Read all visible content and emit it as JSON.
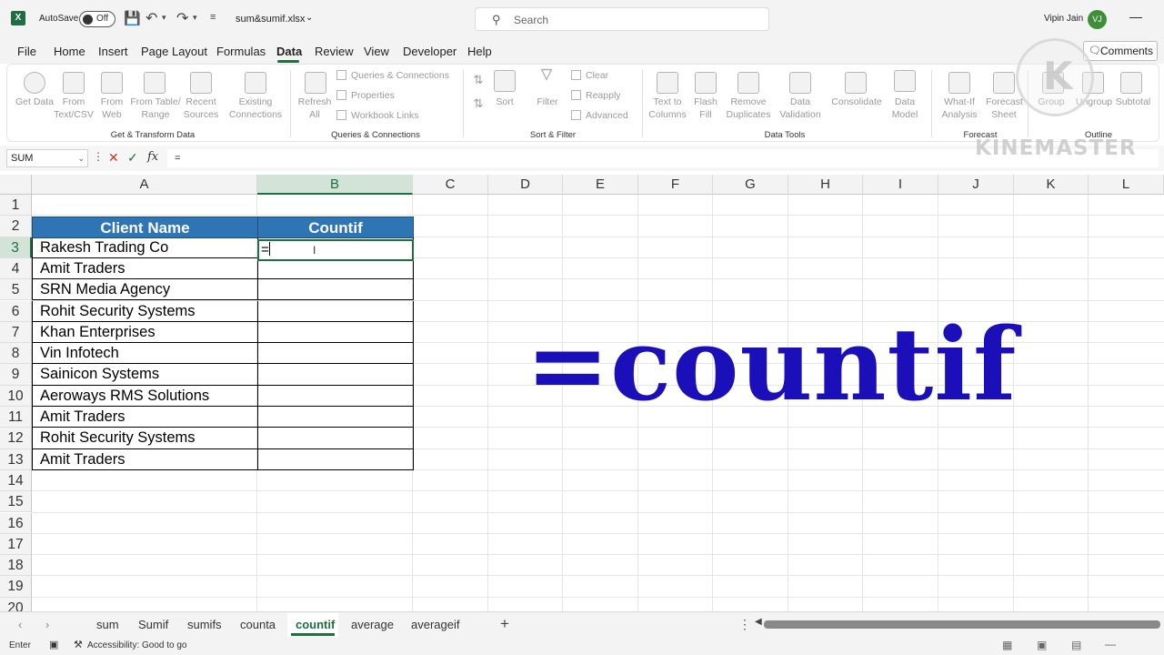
{
  "titlebar": {
    "autosave_label": "AutoSave",
    "autosave_state": "Off",
    "filename": "sum&sumif.xlsx",
    "search_placeholder": "Search",
    "user_name": "Vipin Jain",
    "user_initials": "VJ"
  },
  "menu": {
    "items": [
      "File",
      "Home",
      "Insert",
      "Page Layout",
      "Formulas",
      "Data",
      "Review",
      "View",
      "Developer",
      "Help"
    ],
    "active": "Data",
    "comments_label": "Comments"
  },
  "ribbon": {
    "get_data": "Get Data",
    "from_text_csv": "From Text/CSV",
    "from_web": "From Web",
    "from_table_range": "From Table/ Range",
    "recent_sources": "Recent Sources",
    "existing_connections": "Existing Connections",
    "group_get_transform": "Get & Transform Data",
    "refresh_all": "Refresh All",
    "queries_connections": "Queries & Connections",
    "properties": "Properties",
    "workbook_links": "Workbook Links",
    "group_queries": "Queries & Connections",
    "sort": "Sort",
    "filter": "Filter",
    "clear": "Clear",
    "reapply": "Reapply",
    "advanced": "Advanced",
    "group_sort_filter": "Sort & Filter",
    "text_to_columns": "Text to Columns",
    "flash_fill": "Flash Fill",
    "remove_duplicates": "Remove Duplicates",
    "data_validation": "Data Validation",
    "consolidate": "Consolidate",
    "data_model": "Data Model",
    "group_data_tools": "Data Tools",
    "what_if": "What-If Analysis",
    "forecast_sheet": "Forecast Sheet",
    "group_forecast": "Forecast",
    "group": "Group",
    "ungroup": "Ungroup",
    "subtotal": "Subtotal",
    "group_outline": "Outline"
  },
  "formula_bar": {
    "name_box": "SUM",
    "formula": "="
  },
  "grid": {
    "columns": [
      "A",
      "B",
      "C",
      "D",
      "E",
      "F",
      "G",
      "H",
      "I",
      "J",
      "K",
      "L"
    ],
    "rows": [
      "1",
      "2",
      "3",
      "4",
      "5",
      "6",
      "7",
      "8",
      "9",
      "10",
      "11",
      "12",
      "13",
      "14",
      "15",
      "16",
      "17",
      "18",
      "19",
      "20"
    ],
    "table_header": {
      "a": "Client Name",
      "b": "Countif"
    },
    "clients": [
      "Rakesh Trading Co",
      "Amit Traders",
      "SRN Media Agency",
      "Rohit Security Systems",
      "Khan Enterprises",
      "Vin Infotech",
      "Sainicon Systems",
      "Aeroways RMS Solutions",
      "Amit Traders",
      "Rohit Security Systems",
      "Amit Traders"
    ],
    "active_cell_content": "="
  },
  "overlay": {
    "big_text": "=countif",
    "big_text_color": "#1a0fb8",
    "watermark": "KINEMASTER"
  },
  "sheets": {
    "tabs": [
      "sum",
      "Sumif",
      "sumifs",
      "counta",
      "countif",
      "average",
      "averageif"
    ],
    "active": "countif"
  },
  "status": {
    "mode": "Enter",
    "accessibility": "Accessibility: Good to go"
  },
  "colors": {
    "excel_green": "#1d6f42",
    "table_header_blue": "#2e75b6"
  }
}
